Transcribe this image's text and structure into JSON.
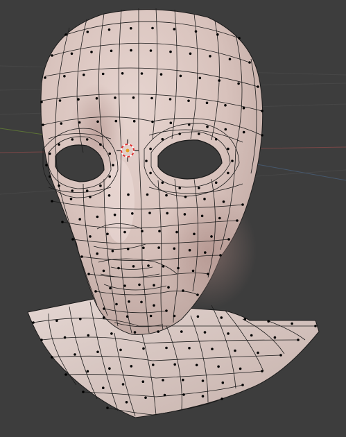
{
  "viewport": {
    "background": "#3d3d3d",
    "grid_line_color": "#474747",
    "axis_x_color": "#8a4b4b",
    "axis_y_color": "#6e8a3d",
    "axis_z_color": "#4d6a8a"
  },
  "mesh": {
    "type": "head-bust",
    "mode": "edit",
    "skin_color": "#d8c2bc",
    "shadow_color": "#b99f99",
    "edge_color": "#1b1b1b",
    "vertex_color": "#000000"
  },
  "cursor_3d": {
    "icon": "crosshair-icon",
    "ring_red": "#e03030",
    "ring_white": "#ffffff",
    "center_color": "#e8a020"
  }
}
